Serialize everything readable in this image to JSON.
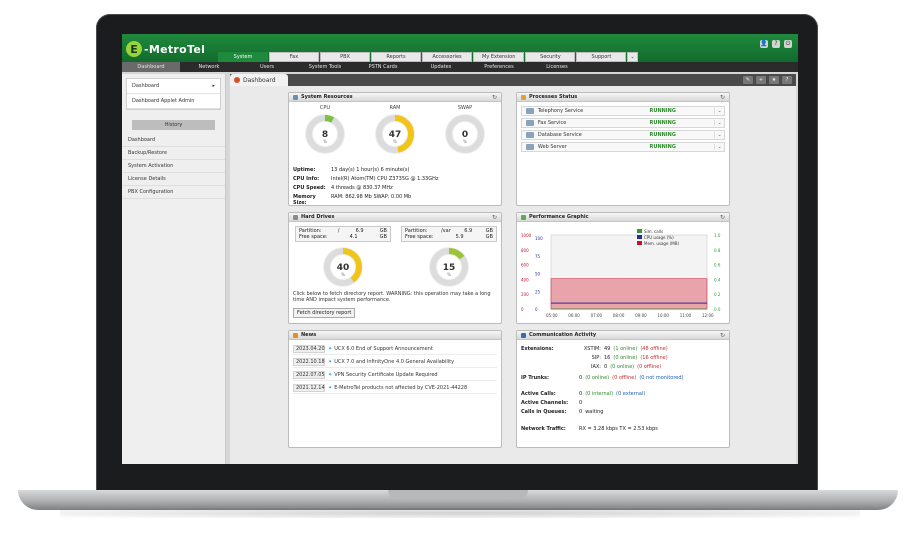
{
  "header": {
    "logo_text": "-MetroTel",
    "logo_letter": "E",
    "top_tabs": [
      "System",
      "Fax",
      "PBX",
      "Reports",
      "Accessories",
      "My Extension",
      "Security",
      "Support"
    ],
    "active_top_tab": "System",
    "icons": [
      "user-icon",
      "help-icon",
      "logout-icon"
    ]
  },
  "subnav": {
    "items": [
      "Dashboard",
      "Network",
      "Users",
      "System Tools",
      "PSTN Cards",
      "Updates",
      "Preferences",
      "Licenses"
    ]
  },
  "sidebar": {
    "items": [
      {
        "label": "Dashboard",
        "arrow": "▸"
      },
      {
        "label": "Dashboard Applet Admin",
        "arrow": ""
      }
    ],
    "history_label": "History",
    "history": [
      "Dashboard",
      "Backup/Restore",
      "System Activation",
      "License Details",
      "PBX Configuration"
    ]
  },
  "dashboard": {
    "tab_label": "Dashboard",
    "tools": [
      "edit-icon",
      "add-icon",
      "star-icon",
      "help-icon"
    ]
  },
  "system_resources": {
    "title": "System Resources",
    "gauges": [
      {
        "label": "CPU",
        "value": "8",
        "percent": 8,
        "color": "#7ac143"
      },
      {
        "label": "RAM",
        "value": "47",
        "percent": 47,
        "color": "#f0c419"
      },
      {
        "label": "SWAP",
        "value": "0",
        "percent": 0,
        "color": "#7ac143"
      }
    ],
    "info": [
      {
        "k": "Uptime:",
        "v": "13 day(s) 1 hour(s) 6 minute(s)"
      },
      {
        "k": "CPU Info:",
        "v": "Intel(R) Atom(TM) CPU Z3735G @ 1.33GHz"
      },
      {
        "k": "CPU Speed:",
        "v": "4 threads @ 830.37 MHz"
      },
      {
        "k": "Memory Size:",
        "v": "RAM: 862.98 Mb   SWAP: 0.00 Mb"
      }
    ]
  },
  "processes": {
    "title": "Processes Status",
    "rows": [
      {
        "name": "Telephony Service",
        "status": "RUNNING"
      },
      {
        "name": "Fax Service",
        "status": "RUNNING"
      },
      {
        "name": "Database Service",
        "status": "RUNNING"
      },
      {
        "name": "Web Server",
        "status": "RUNNING"
      }
    ]
  },
  "hard_drives": {
    "title": "Hard Drives",
    "partitions": [
      {
        "partition_label": "Partition:",
        "partition": "/",
        "size": "6.9",
        "unit": "GB",
        "free_label": "Free space:",
        "free": "4.1",
        "free_unit": "GB",
        "percent": 40,
        "value": "40",
        "color": "#f0c419"
      },
      {
        "partition_label": "Partition:",
        "partition": "/var",
        "size": "6.9",
        "unit": "GB",
        "free_label": "Free space:",
        "free": "5.9",
        "free_unit": "GB",
        "percent": 15,
        "value": "15",
        "color": "#9bc43b"
      }
    ],
    "note": "Click below to fetch directory report. WARNING: this operation may take a long time AND impact system performance.",
    "button": "Fetch directory report"
  },
  "performance": {
    "title": "Performance Graphic",
    "legend": [
      {
        "label": "Sim. calls",
        "color": "#2e9a3a"
      },
      {
        "label": "CPU usage (%)",
        "color": "#2a2aa0"
      },
      {
        "label": "Mem. usage (MB)",
        "color": "#c8102e"
      }
    ]
  },
  "chart_data": {
    "type": "area",
    "x": [
      "05:00",
      "06:00",
      "07:00",
      "08:00",
      "09:00",
      "10:00",
      "11:00",
      "12:00"
    ],
    "y_left_ticks": [
      "1000",
      "800",
      "600",
      "400",
      "200",
      "0"
    ],
    "y_mid_ticks": [
      "100",
      "75",
      "50",
      "25",
      "0"
    ],
    "y_right_ticks": [
      "1.0",
      "0.8",
      "0.6",
      "0.4",
      "0.2",
      "0.0"
    ],
    "series": [
      {
        "name": "Mem. usage (MB)",
        "values": [
          410,
          410,
          410,
          410,
          410,
          410,
          410,
          410
        ]
      },
      {
        "name": "CPU usage (%)",
        "values": [
          8,
          8,
          8,
          8,
          8,
          8,
          8,
          8
        ]
      },
      {
        "name": "Sim. calls",
        "values": [
          0,
          0,
          0,
          0,
          0,
          0,
          0,
          0
        ]
      }
    ],
    "ylim": [
      0,
      1000
    ]
  },
  "news": {
    "title": "News",
    "items": [
      {
        "date": "2023.04.20",
        "text": "UCX 6.0 End of Support Announcement"
      },
      {
        "date": "2022.10.18",
        "text": "UCX 7.0 and InfinityOne 4.0 General Availability"
      },
      {
        "date": "2022.07.05",
        "text": "VPN Security Certificate Update Required"
      },
      {
        "date": "2021.12.14",
        "text": "E-MetroTel products not affected by CVE-2021-44228"
      }
    ]
  },
  "communication": {
    "title": "Communication Activity",
    "extensions_label": "Extensions:",
    "extensions": [
      {
        "proto": "XSTIM:",
        "count": "49",
        "online": "(1 online)",
        "offline": "(48 offline)"
      },
      {
        "proto": "SIP:",
        "count": "16",
        "online": "(0 online)",
        "offline": "(16 offline)"
      },
      {
        "proto": "IAX:",
        "count": "0",
        "online": "(0 online)",
        "offline": "(0 offline)"
      }
    ],
    "ip_trunks_label": "IP Trunks:",
    "ip_trunks": {
      "count": "0",
      "online": "(0 online)",
      "offline": "(0 offline)",
      "nm": "(0 not monitored)"
    },
    "active_calls_label": "Active Calls:",
    "active_calls": {
      "count": "0",
      "internal": "(0 internal)",
      "external": "(0 external)"
    },
    "active_channels_label": "Active Channels:",
    "active_channels": "0",
    "calls_queue_label": "Calls in Queues:",
    "calls_queue": "0",
    "calls_queue_suffix": "waiting",
    "traffic_label": "Network Traffic:",
    "traffic": "RX = 3.28 kbps   TX = 2.53 kbps"
  }
}
